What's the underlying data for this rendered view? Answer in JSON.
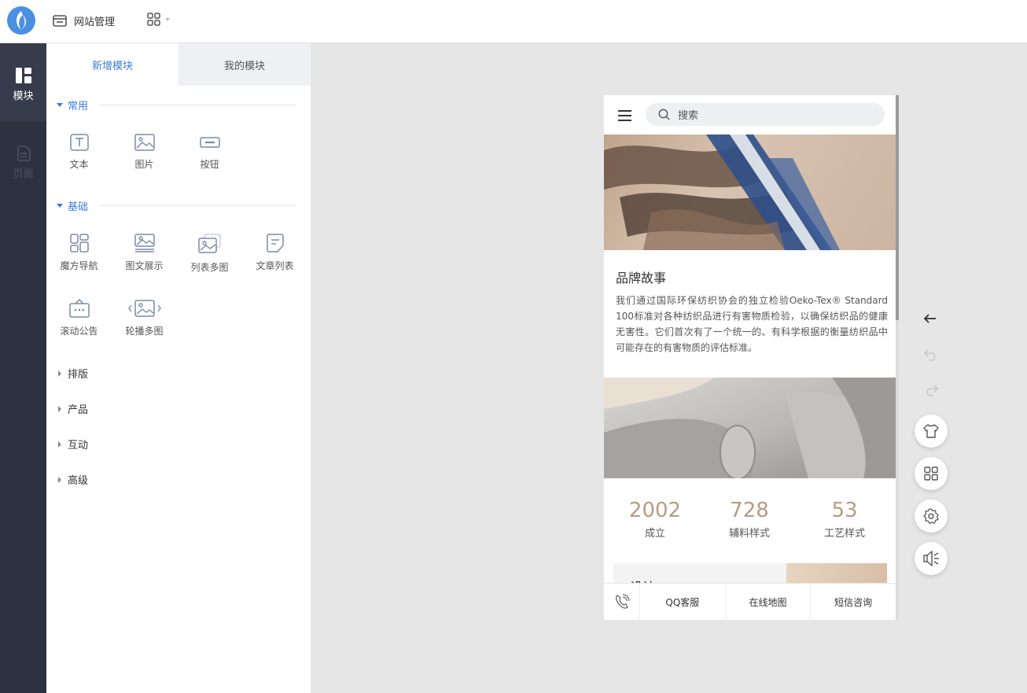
{
  "topbar": {
    "site_manage": "网站管理"
  },
  "rail": {
    "items": [
      {
        "label": "模块"
      },
      {
        "label": "页面"
      }
    ]
  },
  "panel": {
    "tabs": [
      {
        "label": "新增模块"
      },
      {
        "label": "我的模块"
      }
    ],
    "sections": [
      {
        "title": "常用",
        "items": [
          "文本",
          "图片",
          "按钮"
        ]
      },
      {
        "title": "基础",
        "items": [
          "魔方导航",
          "图文展示",
          "列表多图",
          "文章列表",
          "滚动公告",
          "轮播多图"
        ]
      },
      {
        "title": "排版"
      },
      {
        "title": "产品"
      },
      {
        "title": "互动"
      },
      {
        "title": "高级"
      }
    ]
  },
  "phone": {
    "search_placeholder": "搜索",
    "story_title": "品牌故事",
    "story_text": "我们通过国际环保纺织协会的独立检验Oeko-Tex® Standard 100标准对各种纺织品进行有害物质检验，以确保纺织品的健康无害性。它们首次有了一个统一的、有科学根据的衡量纺织品中可能存在的有害物质的评估标准。",
    "stats": [
      {
        "num": "2002",
        "cap": "成立"
      },
      {
        "num": "728",
        "cap": "辅料样式"
      },
      {
        "num": "53",
        "cap": "工艺样式"
      }
    ],
    "card_title": "设计",
    "bottom_bar": [
      "QQ客服",
      "在线地图",
      "短信咨询"
    ]
  },
  "colors": {
    "accent": "#3b7dd8",
    "rail_bg": "#2c3240",
    "stat_num": "#b89b81"
  }
}
